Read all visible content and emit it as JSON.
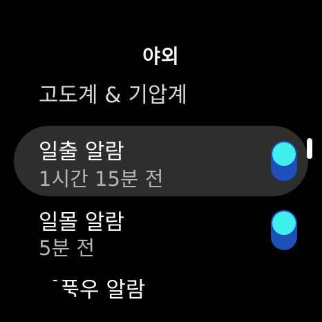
{
  "header": {
    "title": "야외"
  },
  "items": [
    {
      "label": "고도계 & 기압계"
    },
    {
      "label": "일출 알람",
      "sub": "1시간 15분 전",
      "toggle_on": true
    },
    {
      "label": "일몰 알람",
      "sub": "5분 전",
      "toggle_on": true
    },
    {
      "label": "폭풍우 알람"
    }
  ],
  "colors": {
    "background": "#000000",
    "focused_row": "#2e2e2e",
    "toggle_track": "#1f4fb8",
    "toggle_knob": "#3ff0ec",
    "subtext": "#b5b5b5"
  }
}
